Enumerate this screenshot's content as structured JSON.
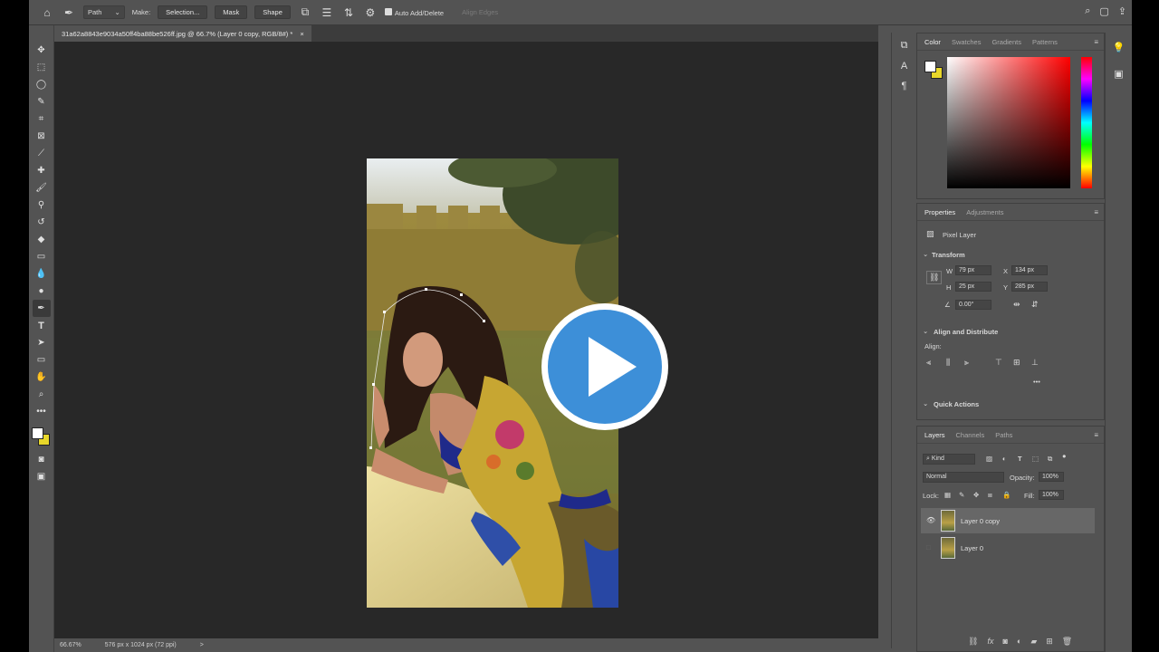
{
  "options_bar": {
    "mode_select": "Path",
    "make_label": "Make:",
    "selection_button": "Selection...",
    "mask_button": "Mask",
    "shape_button": "Shape",
    "auto_add_delete": "Auto Add/Delete",
    "align_edges": "Align Edges"
  },
  "document": {
    "tab_title": "31a62a8843e9034a50ff4ba88be526ff.jpg @ 66.7% (Layer 0 copy, RGB/8#) *",
    "tab_close": "×"
  },
  "status_bar": {
    "zoom": "66.67%",
    "doc_info": "576 px x 1024 px (72 ppi)",
    "arrow": ">"
  },
  "color_panel": {
    "tabs": [
      "Color",
      "Swatches",
      "Gradients",
      "Patterns"
    ],
    "foreground": "#ffffff",
    "background": "#e8d72a",
    "picker_hue": "#ff0000"
  },
  "properties_panel": {
    "tabs": [
      "Properties",
      "Adjustments"
    ],
    "layer_type": "Pixel Layer",
    "transform_title": "Transform",
    "w_label": "W",
    "w_value": "79 px",
    "h_label": "H",
    "h_value": "25 px",
    "x_label": "X",
    "x_value": "134 px",
    "y_label": "Y",
    "y_value": "285 px",
    "angle_value": "0.00°",
    "align_title": "Align and Distribute",
    "align_label": "Align:",
    "more": "•••",
    "quick_actions": "Quick Actions"
  },
  "layers_panel": {
    "tabs": [
      "Layers",
      "Channels",
      "Paths"
    ],
    "filter_kind": "Kind",
    "blend_mode": "Normal",
    "opacity_label": "Opacity:",
    "opacity_value": "100%",
    "lock_label": "Lock:",
    "fill_label": "Fill:",
    "fill_value": "100%",
    "layers": [
      {
        "name": "Layer 0 copy",
        "visible": true,
        "selected": true
      },
      {
        "name": "Layer 0",
        "visible": false,
        "selected": false
      }
    ]
  }
}
